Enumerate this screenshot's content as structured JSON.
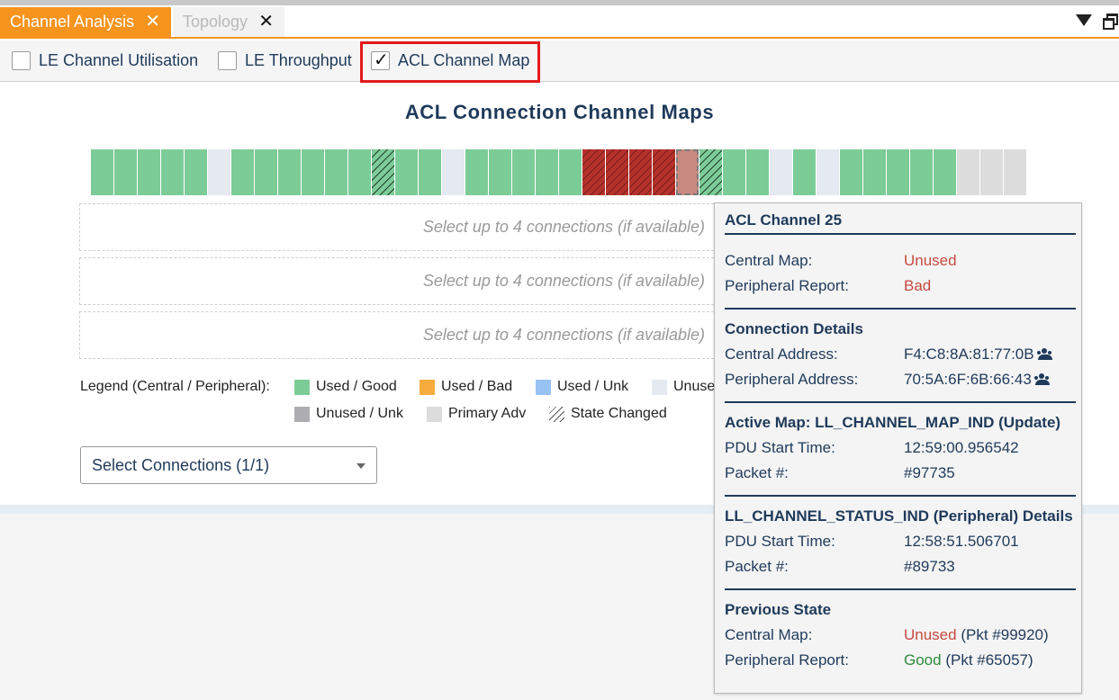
{
  "tabs": [
    {
      "label": "Channel Analysis",
      "active": true
    },
    {
      "label": "Topology",
      "active": false
    }
  ],
  "icons": {
    "close": "close-icon",
    "menu": "triangle-down-icon",
    "restore": "restore-window-icon",
    "user": "people-icon"
  },
  "options": [
    {
      "label": "LE Channel Utilisation",
      "checked": false
    },
    {
      "label": "LE Throughput",
      "checked": false
    },
    {
      "label": "ACL Channel Map",
      "checked": true
    }
  ],
  "title": "ACL Connection Channel Maps",
  "channels": [
    "g",
    "g",
    "g",
    "g",
    "g",
    "u",
    "g",
    "g",
    "g",
    "g",
    "g",
    "g",
    "gh",
    "g",
    "g",
    "u",
    "g",
    "g",
    "g",
    "g",
    "g",
    "r",
    "r",
    "r",
    "r",
    "sel",
    "gh",
    "g",
    "g",
    "u",
    "g",
    "u",
    "g",
    "g",
    "g",
    "g",
    "g",
    "p",
    "p",
    "p"
  ],
  "connection_placeholder": "Select up to 4 connections (if available)",
  "legend": {
    "label": "Legend (Central / Peripheral):",
    "items": [
      {
        "label": "Used / Good",
        "color": "#7ccc97"
      },
      {
        "label": "Used / Bad",
        "color": "#f5ac3c"
      },
      {
        "label": "Used / Unk",
        "color": "#97c3f2"
      },
      {
        "label": "Unuse",
        "color": "#e5e9f0"
      },
      {
        "label": "Unused / Unk",
        "color": "#aeaeb2"
      },
      {
        "label": "Primary Adv",
        "color": "#dcdcdc"
      },
      {
        "label": "State Changed",
        "color": "hatched"
      }
    ]
  },
  "select": {
    "label": "Select Connections (1/1)"
  },
  "tooltip": {
    "title": "ACL Channel 25",
    "central_map_label": "Central Map:",
    "central_map_value": "Unused",
    "peripheral_report_label": "Peripheral Report:",
    "peripheral_report_value": "Bad",
    "connection_details": {
      "heading": "Connection Details",
      "central_address_label": "Central Address:",
      "central_address_value": "F4:C8:8A:81:77:0B",
      "peripheral_address_label": "Peripheral Address:",
      "peripheral_address_value": "70:5A:6F:6B:66:43"
    },
    "active_map": {
      "heading": "Active Map: LL_CHANNEL_MAP_IND (Update)",
      "pdu_label": "PDU Start Time:",
      "pdu_value": "12:59:00.956542",
      "packet_label": "Packet #:",
      "packet_value": "#97735"
    },
    "status_ind": {
      "heading": "LL_CHANNEL_STATUS_IND (Peripheral) Details",
      "pdu_label": "PDU Start Time:",
      "pdu_value": "12:58:51.506701",
      "packet_label": "Packet #:",
      "packet_value": "#89733"
    },
    "previous_state": {
      "heading": "Previous State",
      "central_map_label": "Central Map:",
      "central_map_value": "Unused",
      "central_map_pkt": " (Pkt #99920)",
      "peripheral_report_label": "Peripheral Report:",
      "peripheral_report_value": "Good",
      "peripheral_report_pkt": " (Pkt #65057)"
    }
  }
}
